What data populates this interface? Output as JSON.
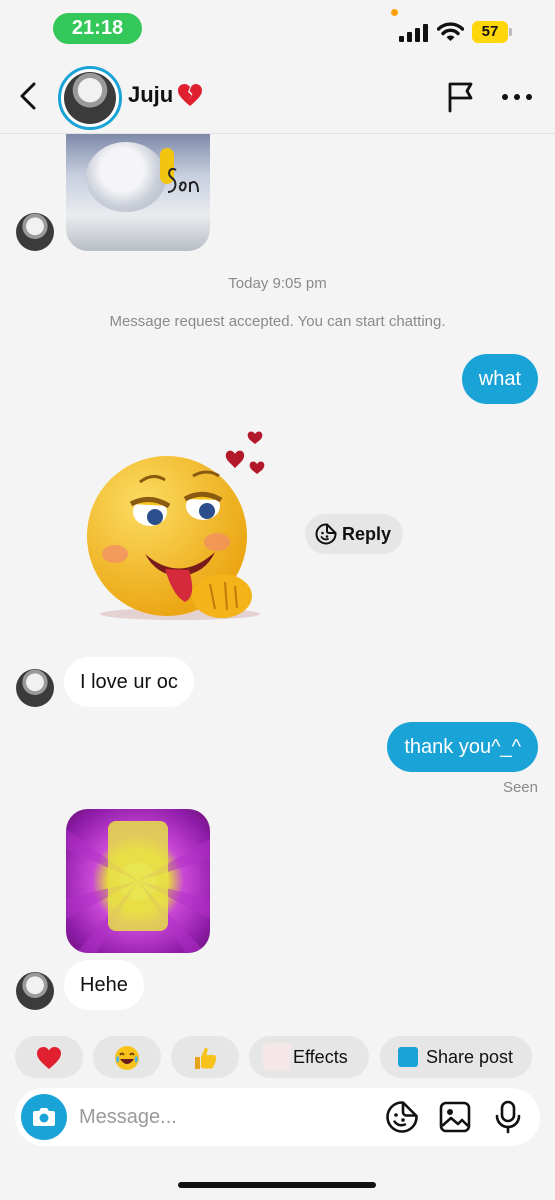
{
  "status_bar": {
    "time": "21:18",
    "battery_level": "57",
    "icons": [
      "cellular-signal-icon",
      "wifi-icon",
      "battery-icon"
    ]
  },
  "header": {
    "contact_name": "Juju",
    "name_emoji_icon": "broken-heart-icon",
    "back_icon": "chevron-left-icon",
    "flag_icon": "flag-icon",
    "more_icon": "more-horizontal-icon"
  },
  "chat": {
    "timestamp": "Today 9:05 pm",
    "system_message": "Message request accepted. You can start chatting.",
    "messages": [
      {
        "from": "them",
        "kind": "image",
        "label": "baby-photo"
      },
      {
        "from": "me",
        "kind": "text",
        "text": "what"
      },
      {
        "from": "them",
        "kind": "sticker",
        "label": "smiling-emoji-sticker"
      },
      {
        "from": "them",
        "kind": "text",
        "text": "I love ur oc"
      },
      {
        "from": "me",
        "kind": "text",
        "text": "thank you^_^"
      },
      {
        "from": "them",
        "kind": "image",
        "label": "spongebob-image"
      },
      {
        "from": "them",
        "kind": "text",
        "text": "Hehe"
      }
    ],
    "reply_label": "Reply",
    "seen_label": "Seen"
  },
  "quick_bar": {
    "reactions": [
      "heart-emoji",
      "laughing-emoji",
      "thumbs-up-emoji"
    ],
    "effects_label": "Effects",
    "share_label": "Share post"
  },
  "composer": {
    "placeholder": "Message...",
    "value": ""
  },
  "colors": {
    "accent": "#1aa3d6",
    "time_pill": "#34c759",
    "battery": "#ffd60a",
    "background": "#f4f4f4"
  }
}
